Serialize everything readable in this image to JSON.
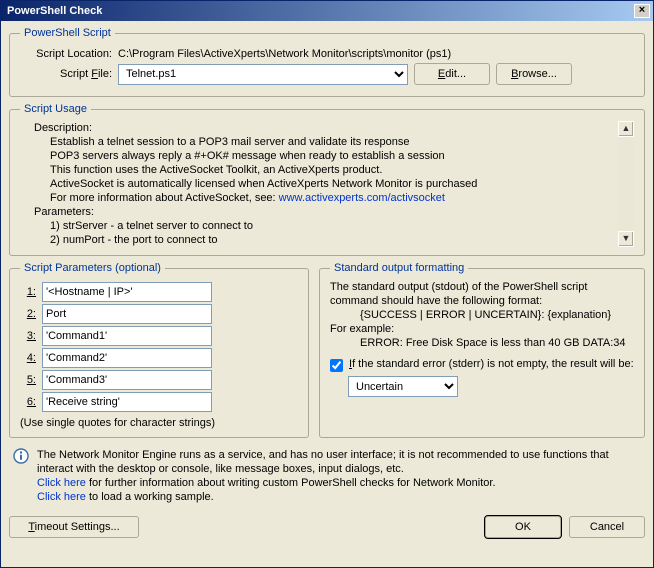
{
  "window": {
    "title": "PowerShell Check",
    "close_glyph": "×"
  },
  "groups": {
    "script": "PowerShell Script",
    "usage": "Script Usage",
    "params": "Script Parameters (optional)",
    "stdout": "Standard output formatting"
  },
  "script": {
    "location_label": "Script Location:",
    "location_value": "C:\\Program Files\\ActiveXperts\\Network Monitor\\scripts\\monitor (ps1)",
    "file_label": "Script File:",
    "file_label_underline": "F",
    "file_value": "Telnet.ps1",
    "edit_btn": "Edit...",
    "edit_underline": "E",
    "browse_btn": "Browse...",
    "browse_underline": "B"
  },
  "usage": {
    "desc_hdr": "Description:",
    "desc_l1": "Establish a telnet session to a POP3 mail server and validate its response",
    "desc_l2": "POP3 servers always reply a #+OK# message when ready to establish a session",
    "desc_l3": "This function uses the ActiveSocket Toolkit, an ActiveXperts product.",
    "desc_l4": "ActiveSocket is automatically licensed when ActiveXperts Network Monitor is purchased",
    "desc_l5_a": "For more information about ActiveSocket, see: ",
    "desc_l5_link": "www.activexperts.com/activsocket",
    "param_hdr": "Parameters:",
    "p1": "1) strServer - a telnet server to connect to",
    "p2": "2) numPort - the port to connect to",
    "scroll_up": "▲",
    "scroll_down": "▼"
  },
  "params": {
    "n1": "1:",
    "v1": "'<Hostname | IP>'",
    "n2": "2:",
    "v2": "Port",
    "n3": "3:",
    "v3": "'Command1'",
    "n4": "4:",
    "v4": "'Command2'",
    "n5": "5:",
    "v5": "'Command3'",
    "n6": "6:",
    "v6": "'Receive string'",
    "hint": "(Use single quotes for character strings)"
  },
  "stdout": {
    "l1": "The standard output (stdout) of the PowerShell script command should have the following format:",
    "l2": "{SUCCESS | ERROR | UNCERTAIN}: {explanation}",
    "l3": "For example:",
    "l4": "ERROR: Free Disk Space is less than 40 GB DATA:34",
    "cb_label": "If the standard error (stderr) is not empty, the result will be:",
    "cb_underline": "I",
    "select_value": "Uncertain"
  },
  "note": {
    "line1": "The Network Monitor Engine runs as a service, and has no user interface; it is not recommended to use functions that interact with the desktop or console, like message boxes, input dialogs, etc.",
    "link1": "Click here",
    "line2_rest": " for further information about writing custom PowerShell checks for Network Monitor.",
    "link2": "Click here",
    "line3_rest": " to load a working sample."
  },
  "buttons": {
    "timeout": "Timeout Settings...",
    "timeout_underline": "T",
    "ok": "OK",
    "cancel": "Cancel"
  }
}
